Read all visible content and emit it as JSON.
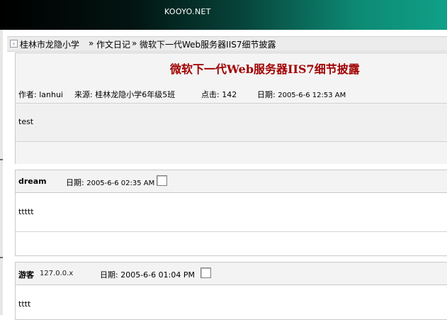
{
  "banner": {
    "site_name": "KOOYO.NET"
  },
  "breadcrumb": {
    "icon": "arrow-icon",
    "items": [
      "桂林市龙隐小学",
      "作文日记",
      "微软下一代Web服务器IIS7细节披露"
    ],
    "separator": "»"
  },
  "article": {
    "title": "微软下一代Web服务器IIS7细节披露",
    "author_label": "作者:",
    "author": "lanhui",
    "source_label": "来源:",
    "source": "桂林龙隐小学6年级5班",
    "clicks_label": "点击:",
    "clicks": "142",
    "date_label": "日期:",
    "date": "2005-6-6 12:53 AM",
    "body": "test"
  },
  "comments": [
    {
      "author": "dream",
      "ip": "",
      "date_label": "日期:",
      "date": "2005-6-6 02:35 AM",
      "body": "ttttt"
    },
    {
      "author": "游客",
      "ip": "127.0.0.x",
      "date_label": "日期:",
      "date": "2005-6-6 01:04 PM",
      "body": "tttt"
    }
  ],
  "colors": {
    "title": "#a00000",
    "banner_start": "#000000",
    "banner_end": "#10a088"
  }
}
